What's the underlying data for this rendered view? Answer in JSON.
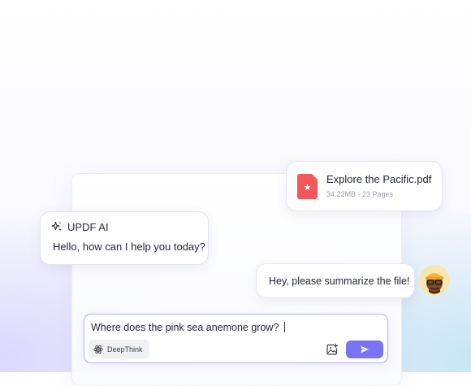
{
  "file_card": {
    "name": "Explore the Pacific.pdf",
    "meta": "34.22MB · 23 Pages",
    "icon": "pdf-file-icon"
  },
  "assistant": {
    "name": "UPDF AI",
    "icon": "sparkle-icon",
    "greeting": "Hello, how can I help you today?"
  },
  "user": {
    "message": "Hey, please summarize the file!",
    "avatar": "memoji-avatar"
  },
  "composer": {
    "input_value": "Where does the pink sea anemone grow?",
    "deepthink_label": "DeepThink",
    "deepthink_icon": "atom-icon",
    "image_icon": "image-upload-icon",
    "send_icon": "send-icon"
  },
  "colors": {
    "accent": "#7b74f2",
    "input_border": "#b8b2f3",
    "pdf_red": "#f2575a"
  }
}
